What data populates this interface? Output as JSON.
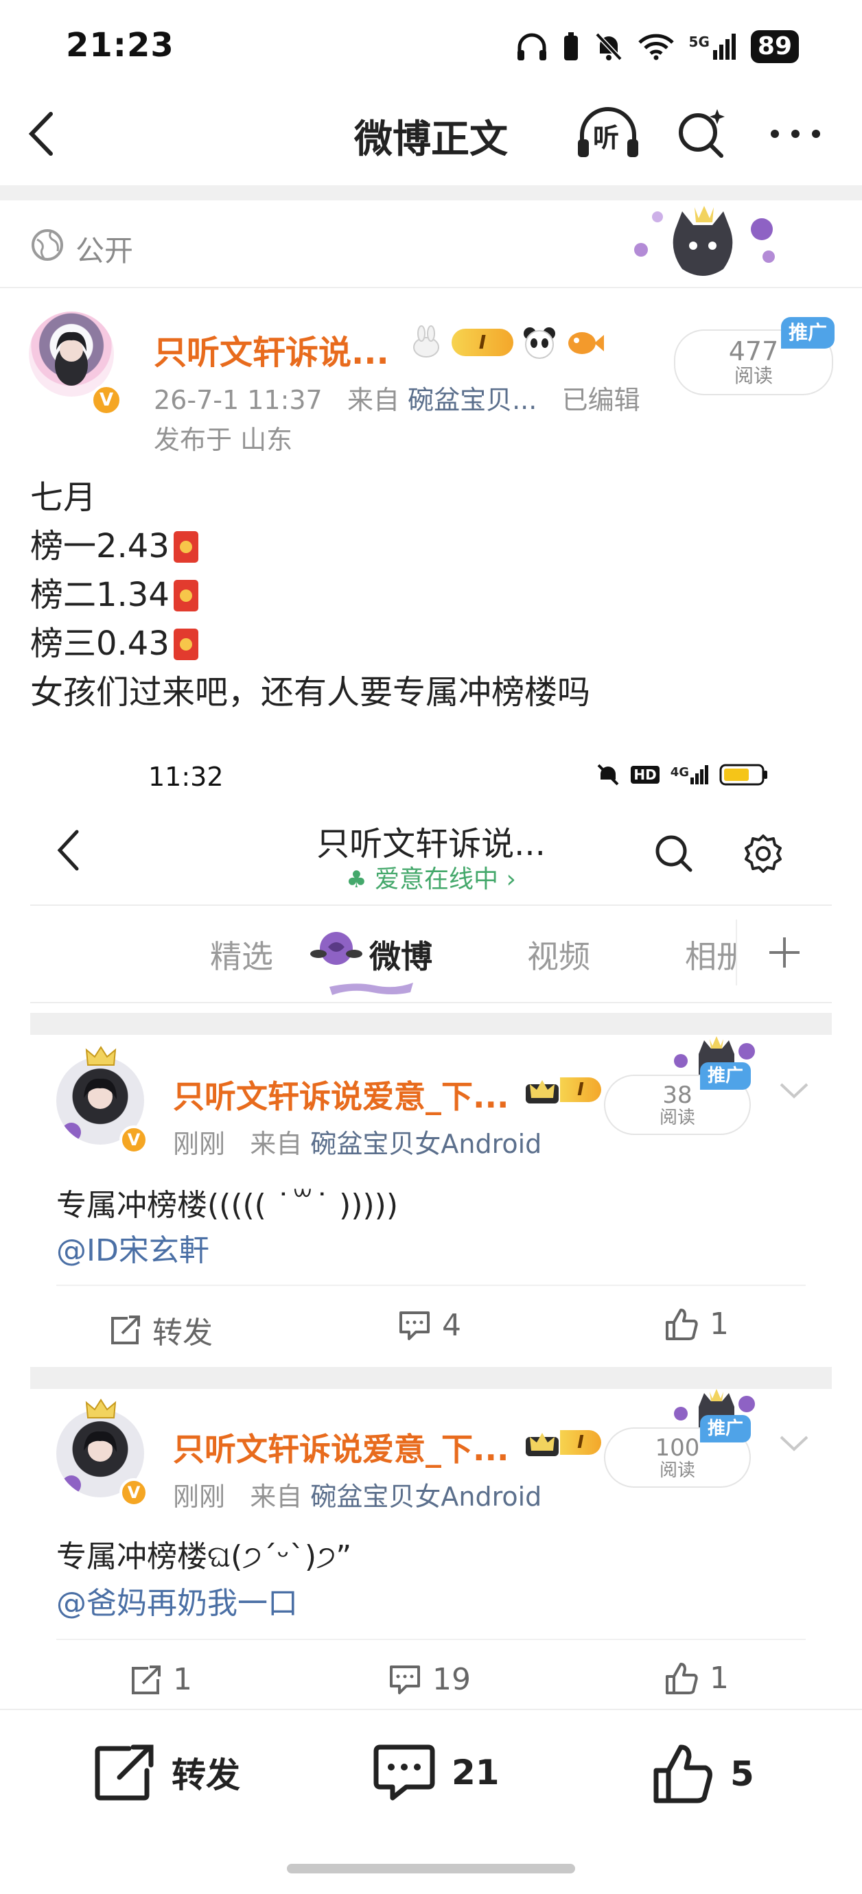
{
  "status_bar": {
    "time": "21:23",
    "network": "5G",
    "battery": "89"
  },
  "header": {
    "title": "微博正文",
    "listen_label": "听"
  },
  "visibility": {
    "label": "公开"
  },
  "post": {
    "author": "只听文轩诉说...",
    "level_badge": "I",
    "timestamp": "26-7-1 11:37",
    "source_prefix": "来自",
    "source": "碗盆宝贝...",
    "edited": "已编辑",
    "location": "发布于 山东",
    "read_count": "477",
    "read_label": "阅读",
    "promo_badge": "推广",
    "lines": [
      "七月",
      "榜一2.43",
      "榜二1.34",
      "榜三0.43",
      "女孩们过来吧，还有人要专属冲榜楼吗"
    ]
  },
  "screenshot": {
    "status": {
      "time": "11:32",
      "hd": "HD",
      "network": "4G"
    },
    "title": "只听文轩诉说...",
    "subtitle": "爱意在线中",
    "tabs": [
      "精选",
      "微博",
      "视频",
      "相册"
    ],
    "active_tab": "微博",
    "cards": [
      {
        "author": "只听文轩诉说爱意_下...",
        "level_badge": "I",
        "time": "刚刚",
        "source_prefix": "来自",
        "source": "碗盆宝贝女Android",
        "read_count": "38",
        "read_label": "阅读",
        "promo_badge": "推广",
        "text": "专属冲榜楼((((( ˙꒳˙ )))))",
        "mention": "@ID宋玄軒",
        "repost": "转发",
        "comments": "4",
        "likes": "1"
      },
      {
        "author": "只听文轩诉说爱意_下...",
        "level_badge": "I",
        "time": "刚刚",
        "source_prefix": "来自",
        "source": "碗盆宝贝女Android",
        "read_count": "100",
        "read_label": "阅读",
        "promo_badge": "推广",
        "text": "专属冲榜楼ଘ(੭ˊᵕˋ)੭”",
        "mention": "@爸妈再奶我一口",
        "repost": "1",
        "comments": "19",
        "likes": "1"
      }
    ]
  },
  "bottom_bar": {
    "repost_label": "转发",
    "comment_count": "21",
    "like_count": "5"
  },
  "colors": {
    "username": "#e86b1d",
    "link": "#4a6fa5",
    "promo": "#4fa3e8",
    "vip": "#f5a623"
  }
}
